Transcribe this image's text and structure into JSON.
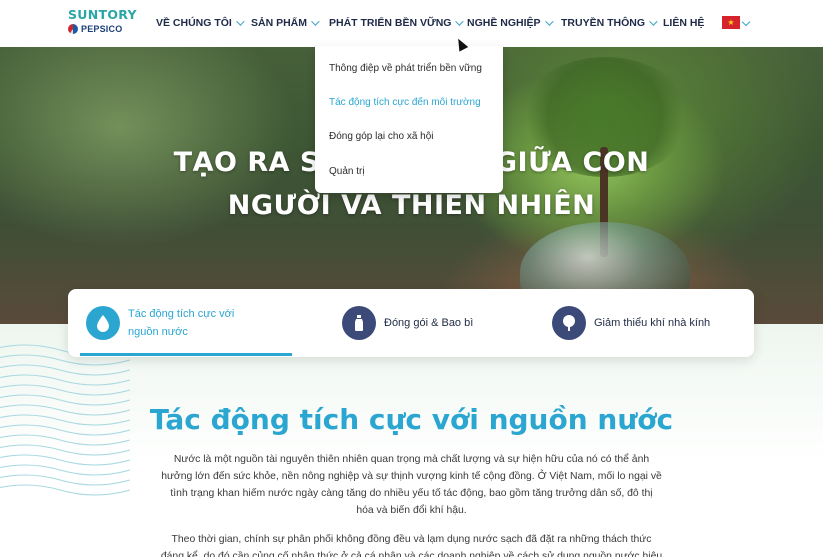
{
  "logo": {
    "top": "SUNTORY",
    "bottom": "PEPSICO"
  },
  "nav": {
    "items": [
      {
        "label": "VỀ CHÚNG TÔI"
      },
      {
        "label": "SẢN PHẨM"
      },
      {
        "label": "PHÁT TRIỂN BỀN VỮNG"
      },
      {
        "label": "NGHỀ NGHIỆP"
      },
      {
        "label": "TRUYỀN THÔNG"
      },
      {
        "label": "LIÊN HỆ"
      }
    ],
    "language_flag": "vietnam-flag-icon"
  },
  "dropdown": {
    "items": [
      {
        "label": "Thông điệp về phát triển bền vững"
      },
      {
        "label": "Tác động tích cực đến môi trường"
      },
      {
        "label": "Đóng góp lại cho xã hội"
      },
      {
        "label": "Quản trị"
      }
    ],
    "active_index": 1
  },
  "hero": {
    "line1": "TẠO RA SỰ HÀI HÒA GIỮA CON",
    "line2": "NGƯỜI VÀ THIÊN NHIÊN"
  },
  "tabs": [
    {
      "label_line1": "Tác động tích cực với",
      "label_line2": "nguồn nước",
      "icon": "water-drop-icon",
      "active": true
    },
    {
      "label": "Đóng gói & Bao bì",
      "icon": "bottle-icon",
      "active": false
    },
    {
      "label": "Giảm thiểu khí nhà kính",
      "icon": "tree-icon",
      "active": false
    }
  ],
  "section": {
    "title": "Tác động tích cực với nguồn nước",
    "para1": [
      "Nước là một nguồn tài nguyên thiên nhiên quan trọng mà chất lượng và sự hiện hữu của nó có thể ảnh",
      "hưởng lớn đến sức khỏe, nền nông nghiệp và sự thịnh vượng kinh tế cộng đồng. Ở Việt Nam, mối lo ngại về",
      "tình trạng khan hiếm nước ngày càng tăng do nhiều yếu tố tác động, bao gồm tăng trưởng dân số, đô thị",
      "hóa và biến đổi khí hậu."
    ],
    "para2": [
      "Theo thời gian, chính sự phân phối không đồng đều và lạm dụng nước sạch đã đặt ra những thách thức",
      "đáng kể, do đó cần củng cố nhận thức ở cả cá nhân và các doanh nghiệp về cách sử dụng nguồn nước hiệu"
    ]
  },
  "colors": {
    "accent": "#2aa6d1",
    "nav_text": "#1e2a47",
    "icon_bg": "#3b4a78",
    "brand_teal": "#2aa6a6"
  }
}
